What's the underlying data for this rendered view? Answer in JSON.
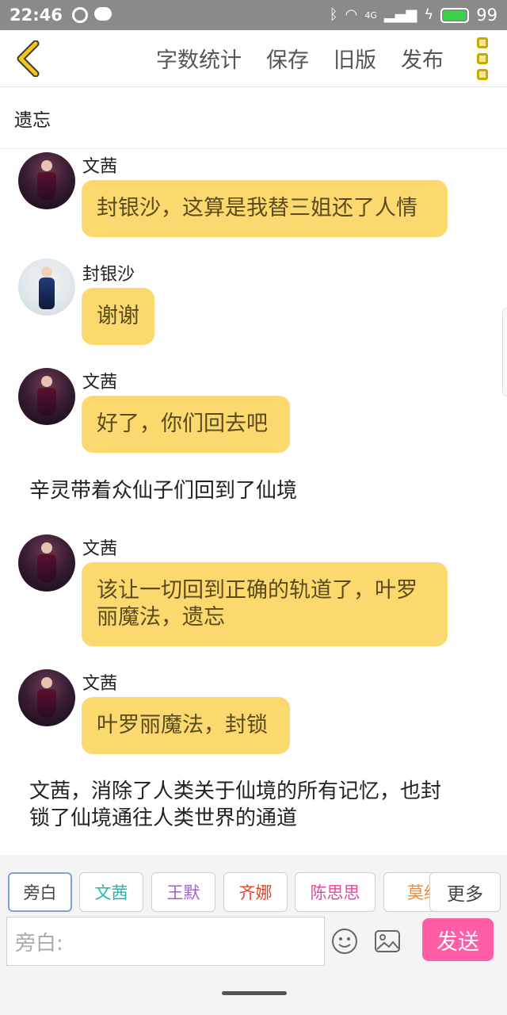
{
  "status_bar": {
    "time": "22:46",
    "network_label": "4G",
    "battery_level": "99",
    "battery_fill_fraction": 0.99,
    "accent_battery": "#3cd34a"
  },
  "toolbar": {
    "back_icon": "chevron-left-icon",
    "actions": [
      "字数统计",
      "保存",
      "旧版",
      "发布"
    ],
    "more_icon": "more-vertical-icon",
    "accent": "#f5c518"
  },
  "document": {
    "title": "遗忘"
  },
  "chat": {
    "bubble_color": "#fcd96e",
    "messages": [
      {
        "sender": "文茜",
        "text": "封银沙，这算是我替三姐还了人情"
      },
      {
        "sender": "封银沙",
        "text": "谢谢"
      },
      {
        "sender": "文茜",
        "text": "好了，你们回去吧"
      },
      {
        "narration": "辛灵带着众仙子们回到了仙境"
      },
      {
        "sender": "文茜",
        "text_lines": [
          "该让一切回到正确的轨道了，叶罗",
          "丽魔法，遗忘"
        ]
      },
      {
        "sender": "文茜",
        "text": "叶罗丽魔法，封锁"
      },
      {
        "narration_lines": [
          "文茜，消除了人类关于仙境的所有记忆，也封",
          "锁了仙境通往人类世界的通道"
        ]
      }
    ]
  },
  "composer": {
    "roles": [
      {
        "label": "旁白",
        "color": "#444444",
        "selected": true
      },
      {
        "label": "文茜",
        "color": "#1fb5b0"
      },
      {
        "label": "王默",
        "color": "#a35bd6"
      },
      {
        "label": "齐娜",
        "color": "#e0452a"
      },
      {
        "label": "陈思思",
        "color": "#e24a9b"
      },
      {
        "label": "莫纱",
        "color": "#f08a3c"
      }
    ],
    "more_label": "更多",
    "input_placeholder": "旁白:",
    "emoji_icon": "emoji-icon",
    "image_icon": "image-icon",
    "send_label": "发送",
    "send_color": "#ff5ea6"
  }
}
